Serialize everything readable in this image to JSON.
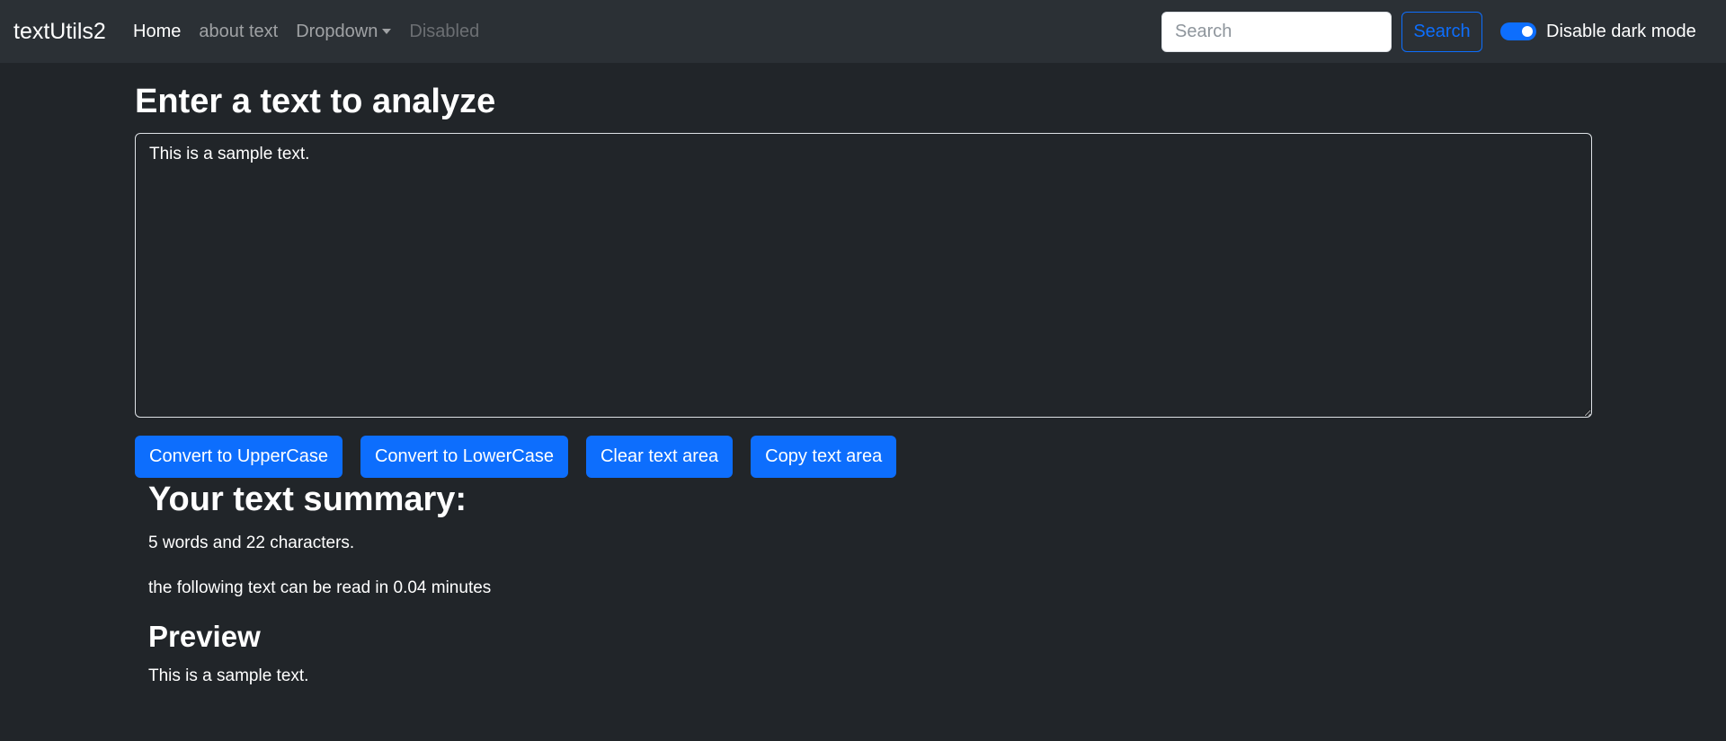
{
  "navbar": {
    "brand": "textUtils2",
    "links": [
      {
        "label": "Home"
      },
      {
        "label": "about text"
      },
      {
        "label": "Dropdown"
      },
      {
        "label": "Disabled"
      }
    ],
    "search": {
      "placeholder": "Search",
      "button_label": "Search"
    },
    "dark_mode_toggle": {
      "label": "Disable dark mode",
      "checked": true
    }
  },
  "editor": {
    "title": "Enter a text to analyze",
    "text": "This is a sample text."
  },
  "buttons": {
    "uppercase": "Convert to UpperCase",
    "lowercase": "Convert to LowerCase",
    "clear": "Clear text area",
    "copy": "Copy text area"
  },
  "summary": {
    "title": "Your text summary:",
    "counts": "5 words and 22 characters.",
    "read_time": "the following text can be read in 0.04 minutes",
    "preview_title": "Preview",
    "preview_text": "This is a sample text."
  },
  "colors": {
    "background": "#212529",
    "navbar": "#2b3035",
    "accent": "#0d6efd"
  }
}
